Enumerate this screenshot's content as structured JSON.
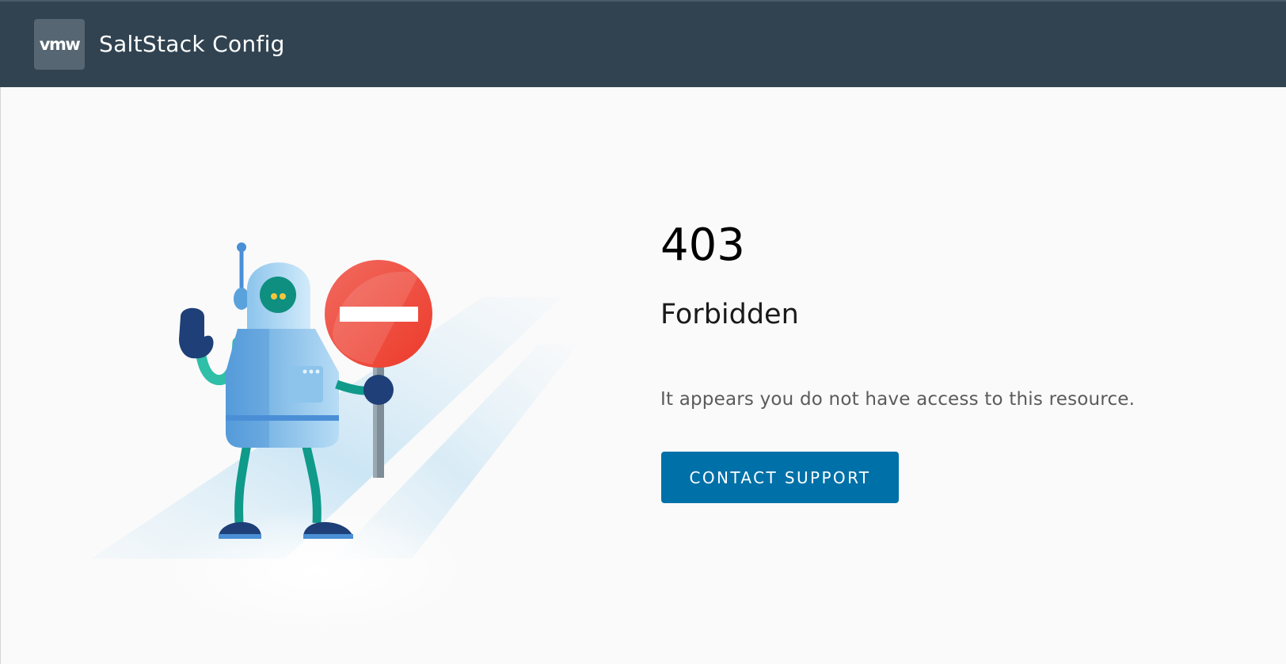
{
  "header": {
    "logo_text": "vmw",
    "app_title": "SaltStack Config"
  },
  "error": {
    "code": "403",
    "title": "Forbidden",
    "message": "It appears you do not have access to this resource.",
    "button_label": "CONTACT SUPPORT"
  },
  "colors": {
    "header_bg": "#314351",
    "page_bg": "#fafafa",
    "button_bg": "#0070a8",
    "stop_sign": "#ef4136"
  },
  "illustration": {
    "icon": "robot-with-stop-sign-icon"
  }
}
